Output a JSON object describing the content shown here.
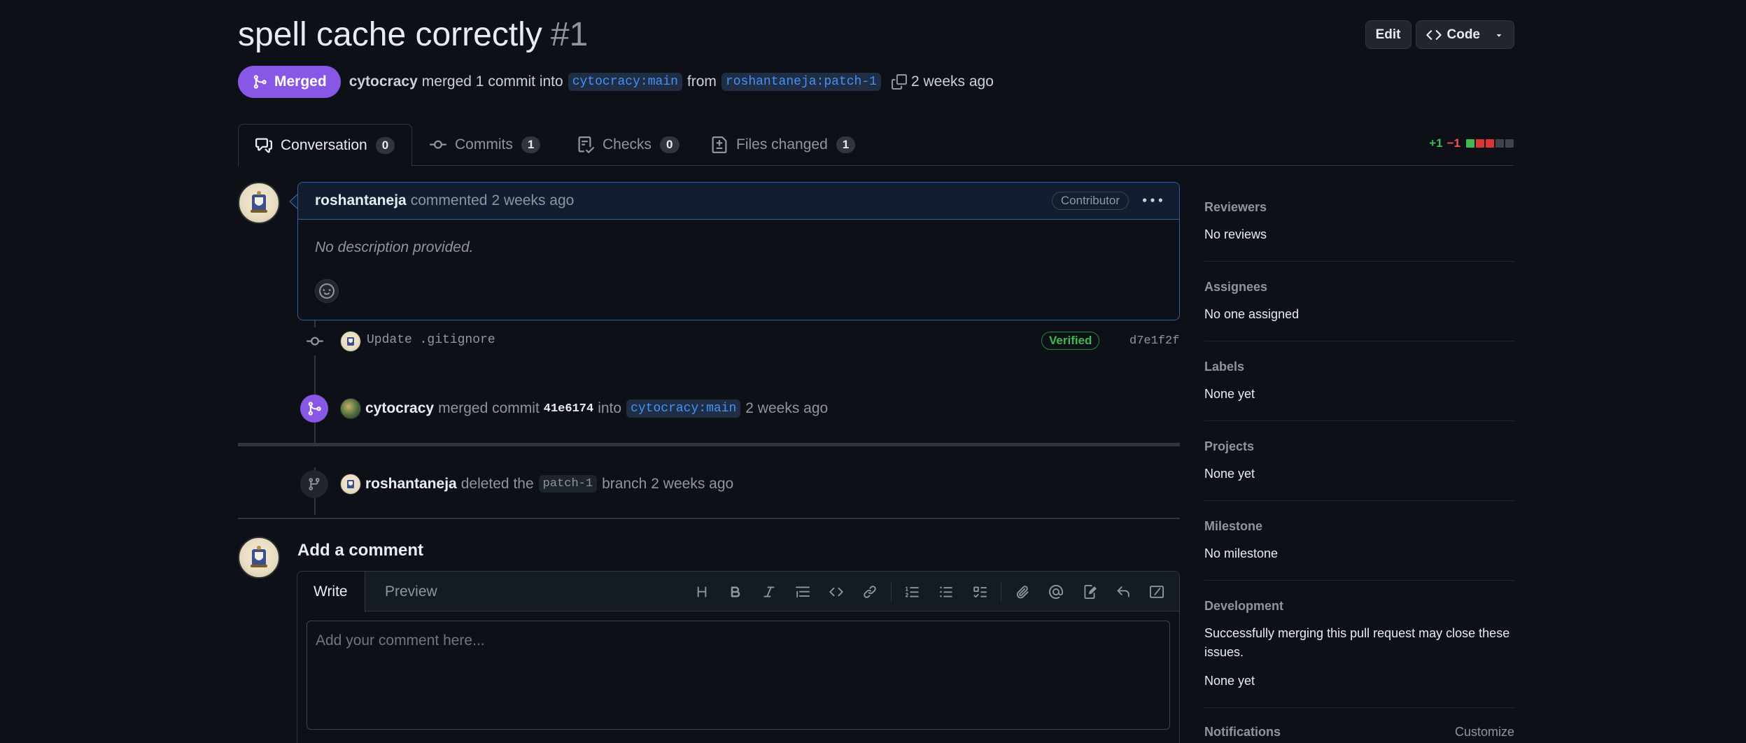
{
  "header": {
    "title": "spell cache correctly",
    "number": "#1",
    "edit_label": "Edit",
    "code_label": "Code"
  },
  "meta": {
    "status": "Merged",
    "author": "cytocracy",
    "action": "merged 1 commit into",
    "base_branch": "cytocracy:main",
    "from_word": "from",
    "head_branch": "roshantaneja:patch-1",
    "time": "2 weeks ago"
  },
  "tabs": [
    {
      "label": "Conversation",
      "count": "0",
      "icon": "comment-discussion-icon"
    },
    {
      "label": "Commits",
      "count": "1",
      "icon": "git-commit-icon"
    },
    {
      "label": "Checks",
      "count": "0",
      "icon": "checklist-icon"
    },
    {
      "label": "Files changed",
      "count": "1",
      "icon": "file-diff-icon"
    }
  ],
  "diffstat": {
    "additions": "+1",
    "deletions": "−1",
    "blocks": [
      "#3fb950",
      "#da3633",
      "#da3633",
      "#3d444d",
      "#3d444d"
    ]
  },
  "comment": {
    "author": "roshantaneja",
    "action": "commented",
    "time": "2 weeks ago",
    "role_badge": "Contributor",
    "body": "No description provided."
  },
  "commit_event": {
    "message": "Update .gitignore",
    "verified": "Verified",
    "sha": "d7e1f2f"
  },
  "merge_event": {
    "author": "cytocracy",
    "action": "merged commit",
    "sha": "41e6174",
    "into": "into",
    "branch": "cytocracy:main",
    "time": "2 weeks ago"
  },
  "delete_event": {
    "author": "roshantaneja",
    "action": "deleted the",
    "branch": "patch-1",
    "suffix": "branch",
    "time": "2 weeks ago"
  },
  "add_comment": {
    "title": "Add a comment",
    "write_tab": "Write",
    "preview_tab": "Preview",
    "placeholder": "Add your comment here...",
    "toolbar_icons": [
      "heading-icon",
      "bold-icon",
      "italic-icon",
      "quote-icon",
      "code-icon",
      "link-icon",
      "ordered-list-icon",
      "unordered-list-icon",
      "task-list-icon",
      "attach-icon",
      "mention-icon",
      "cross-reference-icon",
      "reply-icon",
      "slash-command-icon"
    ]
  },
  "sidebar": {
    "reviewers": {
      "label": "Reviewers",
      "value": "No reviews"
    },
    "assignees": {
      "label": "Assignees",
      "value": "No one assigned"
    },
    "labels": {
      "label": "Labels",
      "value": "None yet"
    },
    "projects": {
      "label": "Projects",
      "value": "None yet"
    },
    "milestone": {
      "label": "Milestone",
      "value": "No milestone"
    },
    "development": {
      "label": "Development",
      "text": "Successfully merging this pull request may close these issues.",
      "value": "None yet"
    },
    "notifications": {
      "label": "Notifications",
      "action": "Customize"
    }
  },
  "colors": {
    "background": "#0d1117",
    "merged_purple": "#8957e5",
    "link_blue": "#4493f8",
    "verified_green": "#3fb950",
    "border": "#30363d"
  }
}
